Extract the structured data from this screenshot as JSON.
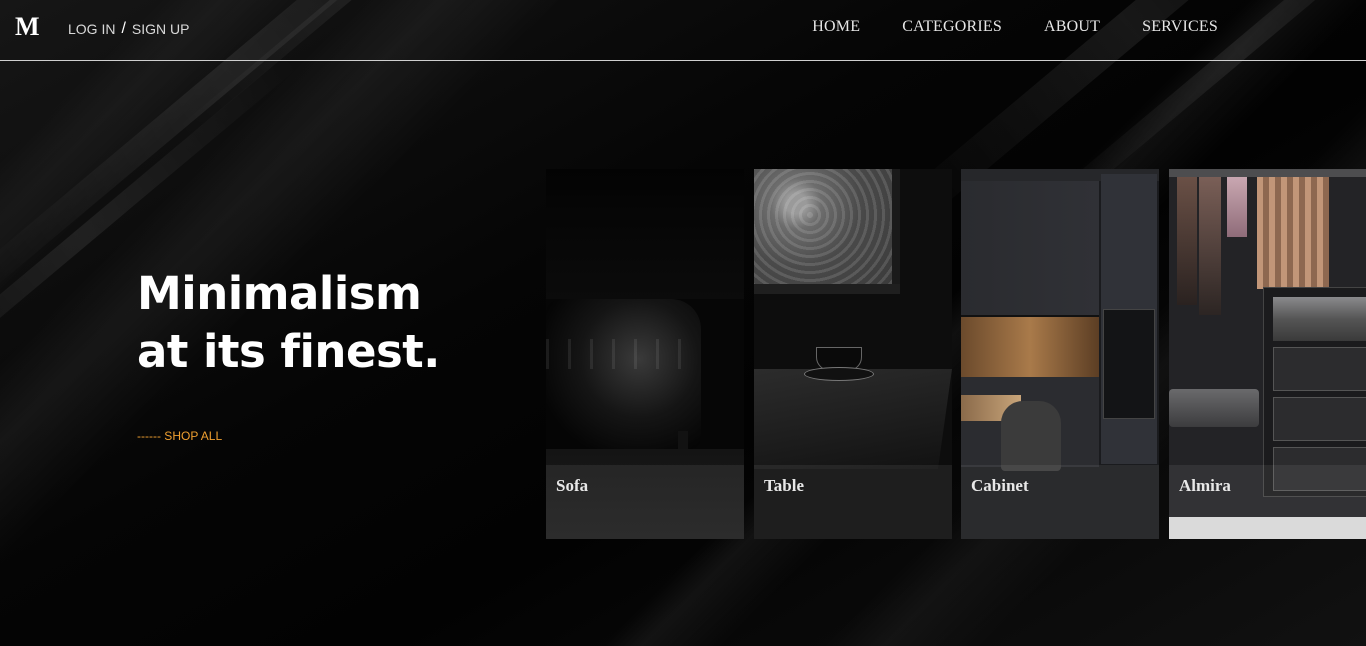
{
  "header": {
    "logo": "M",
    "auth": {
      "login": "LOG IN",
      "separator": "/",
      "signup": "SIGN UP"
    },
    "nav": [
      "HOME",
      "CATEGORIES",
      "ABOUT",
      "SERVICES"
    ]
  },
  "hero": {
    "title_line1": "Minimalism",
    "title_line2": "at its finest.",
    "cta": "------ SHOP ALL",
    "cta_color": "#f0a030"
  },
  "categories": [
    {
      "label": "Sofa",
      "image": "black leather tufted armchair"
    },
    {
      "label": "Table",
      "image": "dark table with coffee cup by window"
    },
    {
      "label": "Cabinet",
      "image": "dark kitchen cabinets with oven"
    },
    {
      "label": "Almira",
      "image": "wardrobe with hanging clothes and drawers"
    }
  ]
}
